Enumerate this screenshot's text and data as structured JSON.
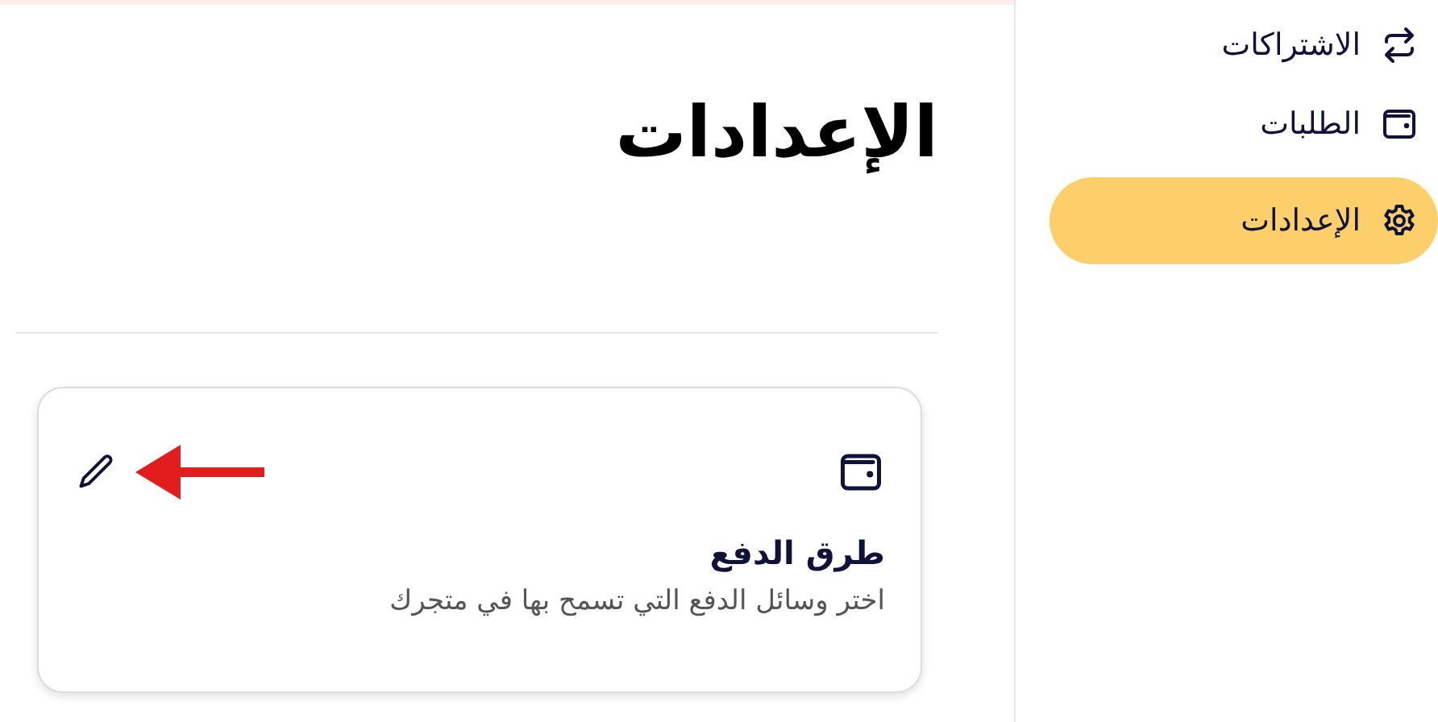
{
  "sidebar": {
    "items": [
      {
        "kind": "repeat",
        "label": "الاشتراكات",
        "selected": false
      },
      {
        "kind": "wallet",
        "label": "الطلبات",
        "selected": false
      },
      {
        "kind": "gear",
        "label": "الإعدادات",
        "selected": true
      }
    ]
  },
  "page_title": "الإعدادات",
  "card": {
    "title": "طرق الدفع",
    "description": "اختر وسائل الدفع التي تسمح بها في متجرك",
    "annotation_arrow": true
  }
}
